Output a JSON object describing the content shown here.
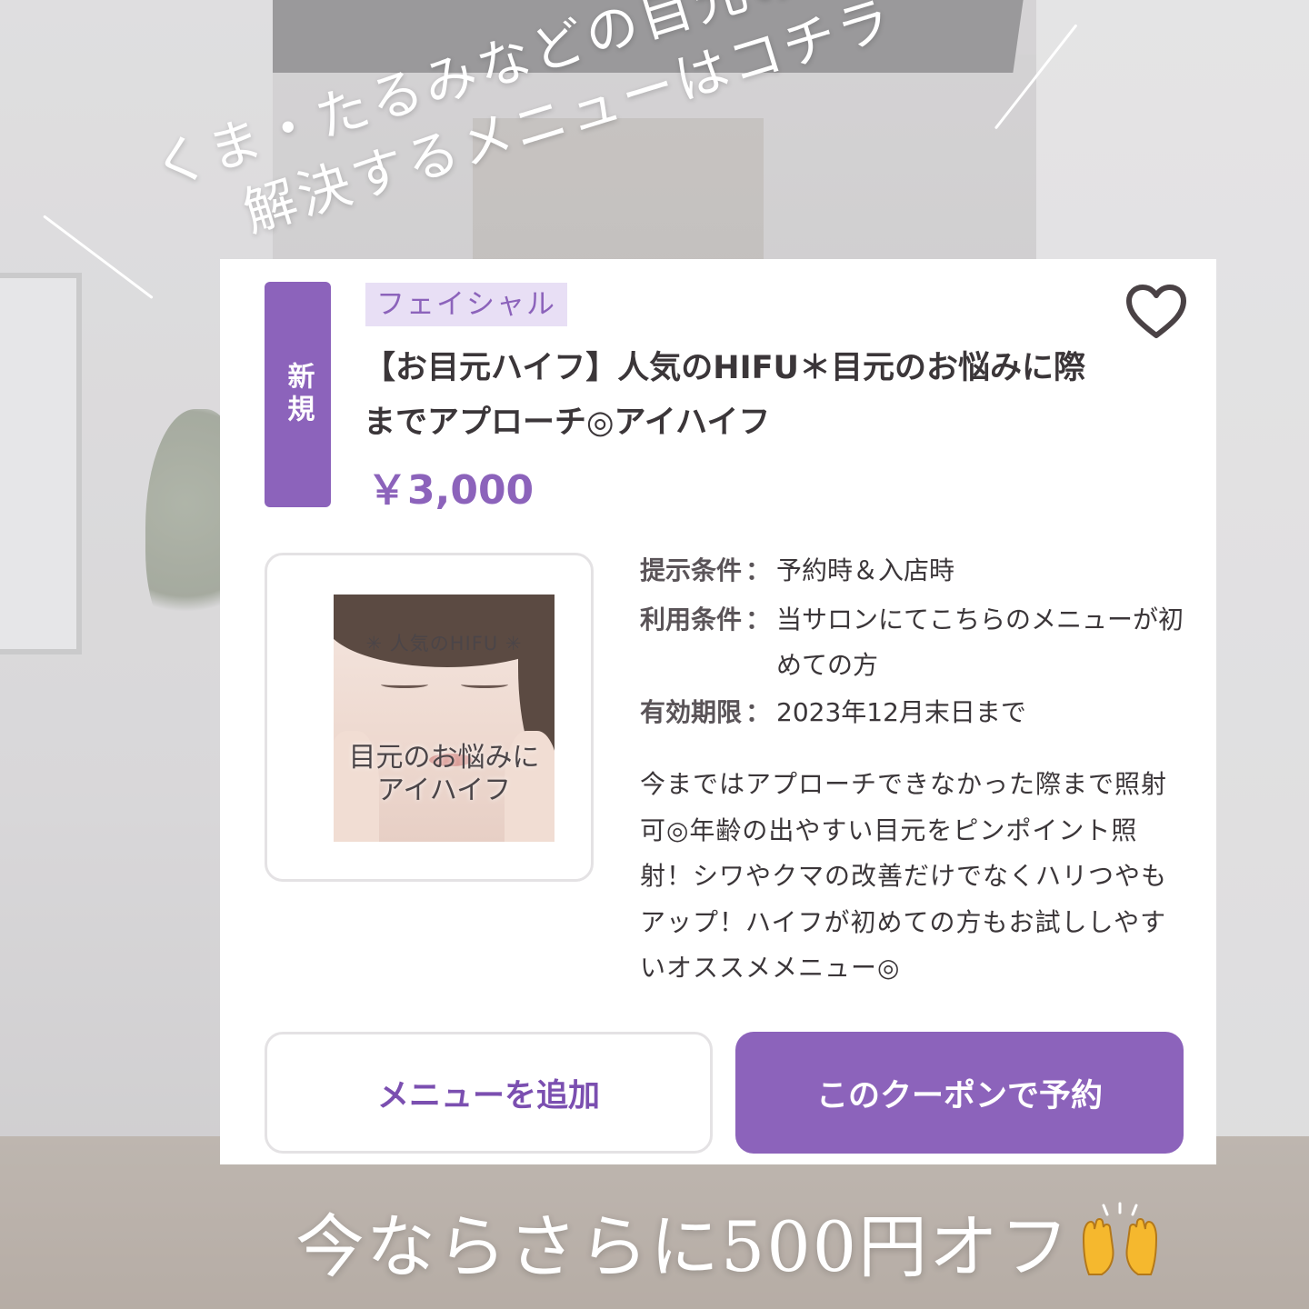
{
  "headline": {
    "line1": "くま・たるみなどの目元のお悩みを",
    "line2": "解決するメニューはコチラ"
  },
  "card": {
    "new_badge": "新規",
    "category": "フェイシャル",
    "title": "【お目元ハイフ】人気のHIFU＊目元のお悩みに際までアプローチ◎アイハイフ",
    "price": "￥3,000",
    "thumbnail": {
      "top_text": "✳ 人気のHIFU ✳",
      "caption_line1": "目元のお悩みに",
      "caption_line2": "アイハイフ"
    },
    "conditions": [
      {
        "label": "提示条件",
        "value": "予約時＆入店時"
      },
      {
        "label": "利用条件",
        "value": "当サロンにてこちらのメニューが初めての方"
      },
      {
        "label": "有効期限",
        "value": "2023年12月末日まで"
      }
    ],
    "description": "今まではアプローチできなかった際まで照射可◎年齢の出やすい目元をピンポイント照射！シワやクマの改善だけでなくハリつやもアップ！ハイフが初めての方もお試ししやすいオススメメニュー◎",
    "add_menu_label": "メニューを追加",
    "book_coupon_label": "このクーポンで予約",
    "favorite_icon": "heart-icon"
  },
  "promo": {
    "text": "今ならさらに500円オフ",
    "emoji_icon": "raising-hands-icon"
  },
  "colors": {
    "accent": "#8c63bb",
    "tag_bg": "#e8dff5",
    "text": "#3b3639"
  }
}
